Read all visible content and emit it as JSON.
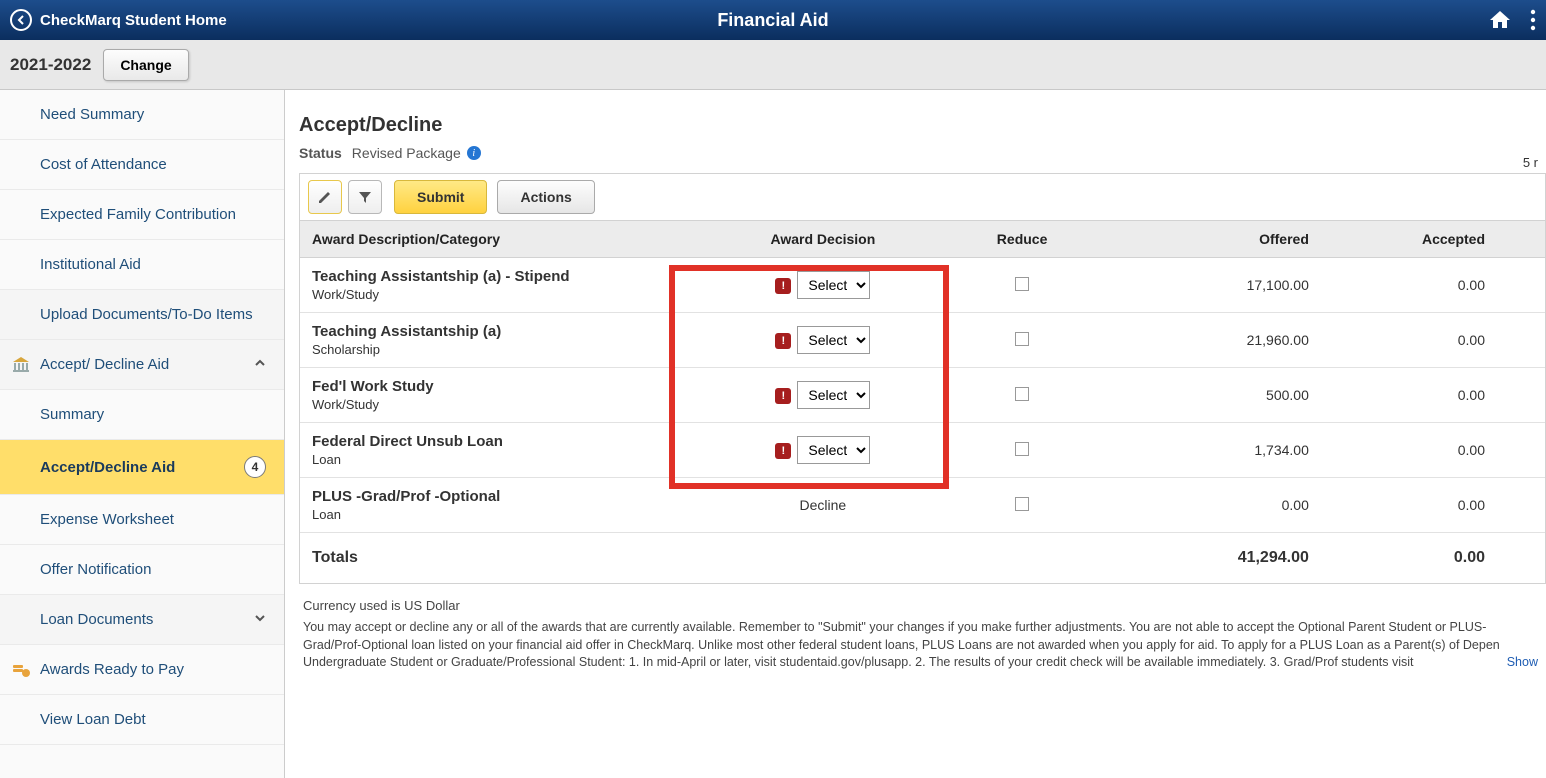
{
  "topbar": {
    "left_title": "CheckMarq Student Home",
    "center_title": "Financial Aid"
  },
  "subbar": {
    "year": "2021-2022",
    "change_label": "Change"
  },
  "sidebar": {
    "items": [
      {
        "label": "Need Summary"
      },
      {
        "label": "Cost of Attendance"
      },
      {
        "label": "Expected Family Contribution"
      },
      {
        "label": "Institutional Aid"
      },
      {
        "label": "Upload Documents/To-Do Items"
      },
      {
        "label": "Accept/ Decline Aid",
        "expanded": true,
        "icon": "bank"
      },
      {
        "label": "Summary"
      },
      {
        "label": "Accept/Decline Aid",
        "active": true,
        "badge": "4"
      },
      {
        "label": "Expense Worksheet"
      },
      {
        "label": "Offer Notification"
      },
      {
        "label": "Loan Documents",
        "expanded": false
      },
      {
        "label": "Awards Ready to Pay",
        "icon": "coins"
      },
      {
        "label": "View Loan Debt"
      }
    ]
  },
  "main": {
    "title": "Accept/Decline",
    "status_label": "Status",
    "status_value": "Revised Package",
    "row_count_suffix": "5 r",
    "toolbar": {
      "submit": "Submit",
      "actions": "Actions"
    },
    "columns": {
      "c1": "Award Description/Category",
      "c2": "Award Decision",
      "c3": "Reduce",
      "c4": "Offered",
      "c5": "Accepted"
    },
    "select_placeholder": "Select",
    "rows": [
      {
        "name": "Teaching Assistantship (a) - Stipend",
        "category": "Work/Study",
        "decision": "select",
        "reduce": false,
        "offered": "17,100.00",
        "accepted": "0.00"
      },
      {
        "name": "Teaching Assistantship (a)",
        "category": "Scholarship",
        "decision": "select",
        "reduce": false,
        "offered": "21,960.00",
        "accepted": "0.00"
      },
      {
        "name": "Fed'l Work Study",
        "category": "Work/Study",
        "decision": "select",
        "reduce": false,
        "offered": "500.00",
        "accepted": "0.00"
      },
      {
        "name": "Federal Direct Unsub Loan",
        "category": "Loan",
        "decision": "select",
        "reduce": false,
        "offered": "1,734.00",
        "accepted": "0.00"
      },
      {
        "name": "PLUS -Grad/Prof -Optional",
        "category": "Loan",
        "decision": "Decline",
        "reduce": false,
        "offered": "0.00",
        "accepted": "0.00"
      }
    ],
    "totals": {
      "label": "Totals",
      "offered": "41,294.00",
      "accepted": "0.00"
    },
    "currency_note": "Currency used is US Dollar",
    "disclosure": "You may accept or decline any or all of the awards that are currently available. Remember to \"Submit\" your changes if you make further adjustments. You are not able to accept the Optional Parent Student or PLUS-Grad/Prof-Optional loan listed on your financial aid offer in CheckMarq. Unlike most other federal student loans, PLUS Loans are not awarded when you apply for aid. To apply for a PLUS Loan as a Parent(s) of Depen Undergraduate Student or Graduate/Professional Student: 1. In mid-April or later, visit studentaid.gov/plusapp. 2. The results of your credit check will be available immediately. 3. Grad/Prof students visit",
    "show_label": "Show"
  }
}
